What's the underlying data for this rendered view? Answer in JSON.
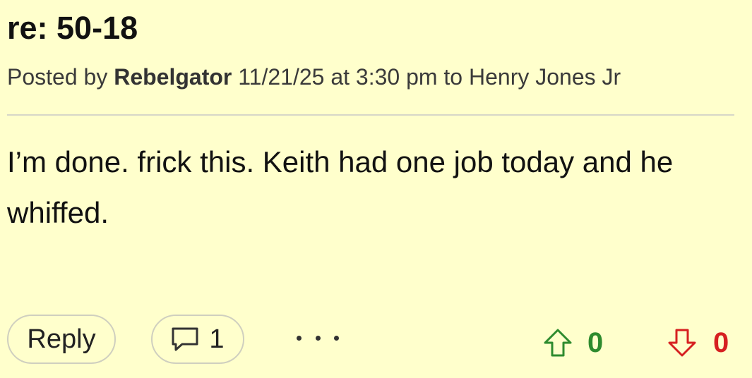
{
  "post": {
    "title": "re: 50-18",
    "meta_prefix": "Posted by",
    "author": "Rebelgator",
    "timestamp": "11/21/25 at 3:30 pm",
    "reply_to_prefix": "to",
    "reply_to_user": "Henry Jones Jr",
    "body": "I’m done. frick this. Keith had one job today and he whiffed."
  },
  "actions": {
    "reply_label": "Reply",
    "comment_count": "1",
    "upvotes": "0",
    "downvotes": "0"
  },
  "icons": {
    "comment": "speech-bubble-icon",
    "more": "more-dots-icon",
    "upvote": "up-arrow-icon",
    "downvote": "down-arrow-icon"
  },
  "colors": {
    "background": "#ffffcc",
    "upvote": "#2e8b2e",
    "downvote": "#d62020"
  }
}
